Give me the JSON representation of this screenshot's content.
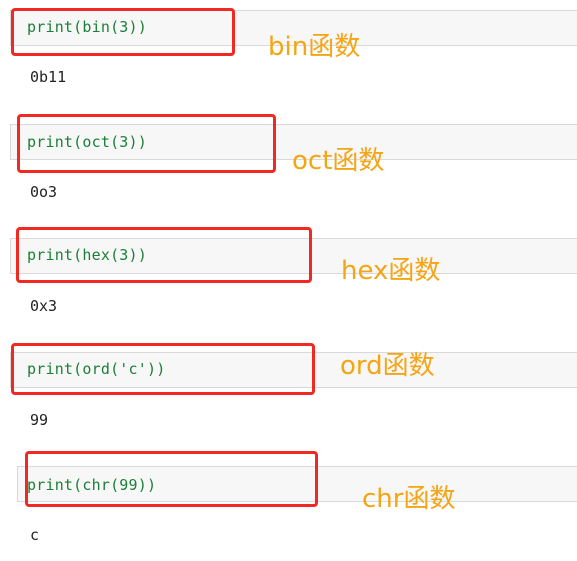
{
  "cells": [
    {
      "code": "print(bin(3))",
      "output": "0b11",
      "annotation": "bin函数"
    },
    {
      "code": "print(oct(3))",
      "output": "0o3",
      "annotation": "oct函数"
    },
    {
      "code": "print(hex(3))",
      "output": "0x3",
      "annotation": "hex函数"
    },
    {
      "code": "print(ord('c'))",
      "output": "99",
      "annotation": "ord函数"
    },
    {
      "code": "print(chr(99))",
      "output": "c",
      "annotation": "chr函数"
    }
  ],
  "colors": {
    "code_text": "#1a7f37",
    "highlight_box": "#f02a22",
    "annotation_text": "#f5a514",
    "cell_background": "#f7f7f7"
  }
}
